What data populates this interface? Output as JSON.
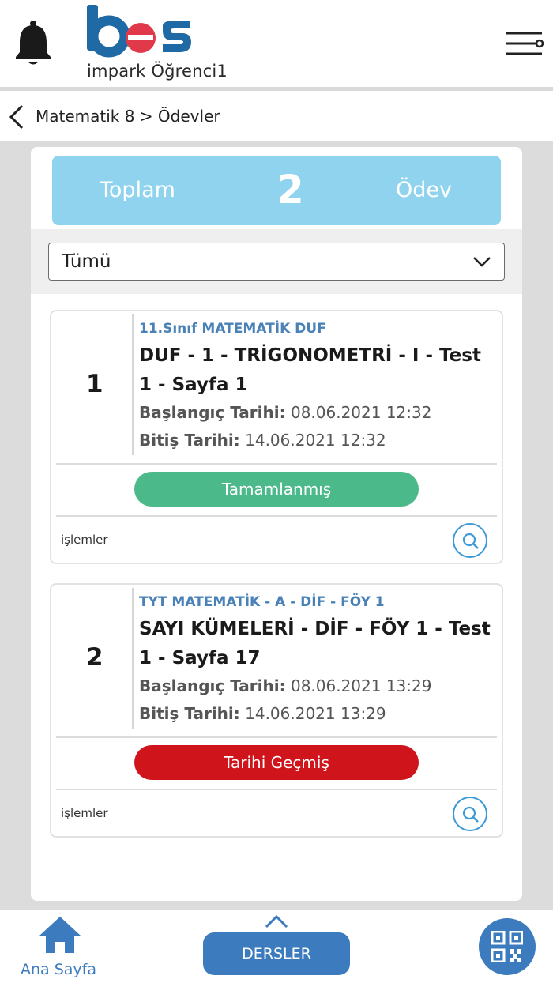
{
  "header": {
    "logo_text": "bes",
    "subtitle": "impark Öğrenci1"
  },
  "breadcrumb": {
    "text": "Matematik 8 > Ödevler"
  },
  "summary": {
    "left_label": "Toplam",
    "count": "2",
    "right_label": "Ödev"
  },
  "filter": {
    "selected": "Tümü"
  },
  "assignments": [
    {
      "number": "1",
      "course": "11.Sınıf MATEMATİK DUF",
      "title": "DUF - 1 - TRİGONOMETRİ - I - Test 1 - Sayfa 1",
      "start_label": "Başlangıç Tarihi:",
      "start_value": " 08.06.2021 12:32",
      "end_label": "Bitiş Tarihi:",
      "end_value": " 14.06.2021 12:32",
      "status": "Tamamlanmış",
      "status_color": "#4cb98b",
      "actions_label": "işlemler"
    },
    {
      "number": "2",
      "course": "TYT MATEMATİK - A - DİF - FÖY 1",
      "title": "SAYI KÜMELERİ - DİF - FÖY 1 - Test 1 - Sayfa 17",
      "start_label": "Başlangıç Tarihi:",
      "start_value": " 08.06.2021 13:29",
      "end_label": "Bitiş Tarihi:",
      "end_value": " 14.06.2021 13:29",
      "status": "Tarihi Geçmiş",
      "status_color": "#d0141c",
      "actions_label": "işlemler"
    }
  ],
  "bottom_nav": {
    "home_label": "Ana Sayfa",
    "center_button": "DERSLER"
  },
  "colors": {
    "accent_blue": "#3d7bbf",
    "summary_bg": "#8fd3ee",
    "course_text": "#4a82b8",
    "logo_blue": "#1f6aa5",
    "logo_red": "#e03a4a"
  },
  "icons": {
    "bell": "bell-icon",
    "menu": "menu-icon",
    "back": "chevron-left-icon",
    "dropdown": "chevron-down-icon",
    "search": "search-icon",
    "home": "home-icon",
    "up": "chevron-up-icon",
    "qr": "qr-code-icon"
  }
}
